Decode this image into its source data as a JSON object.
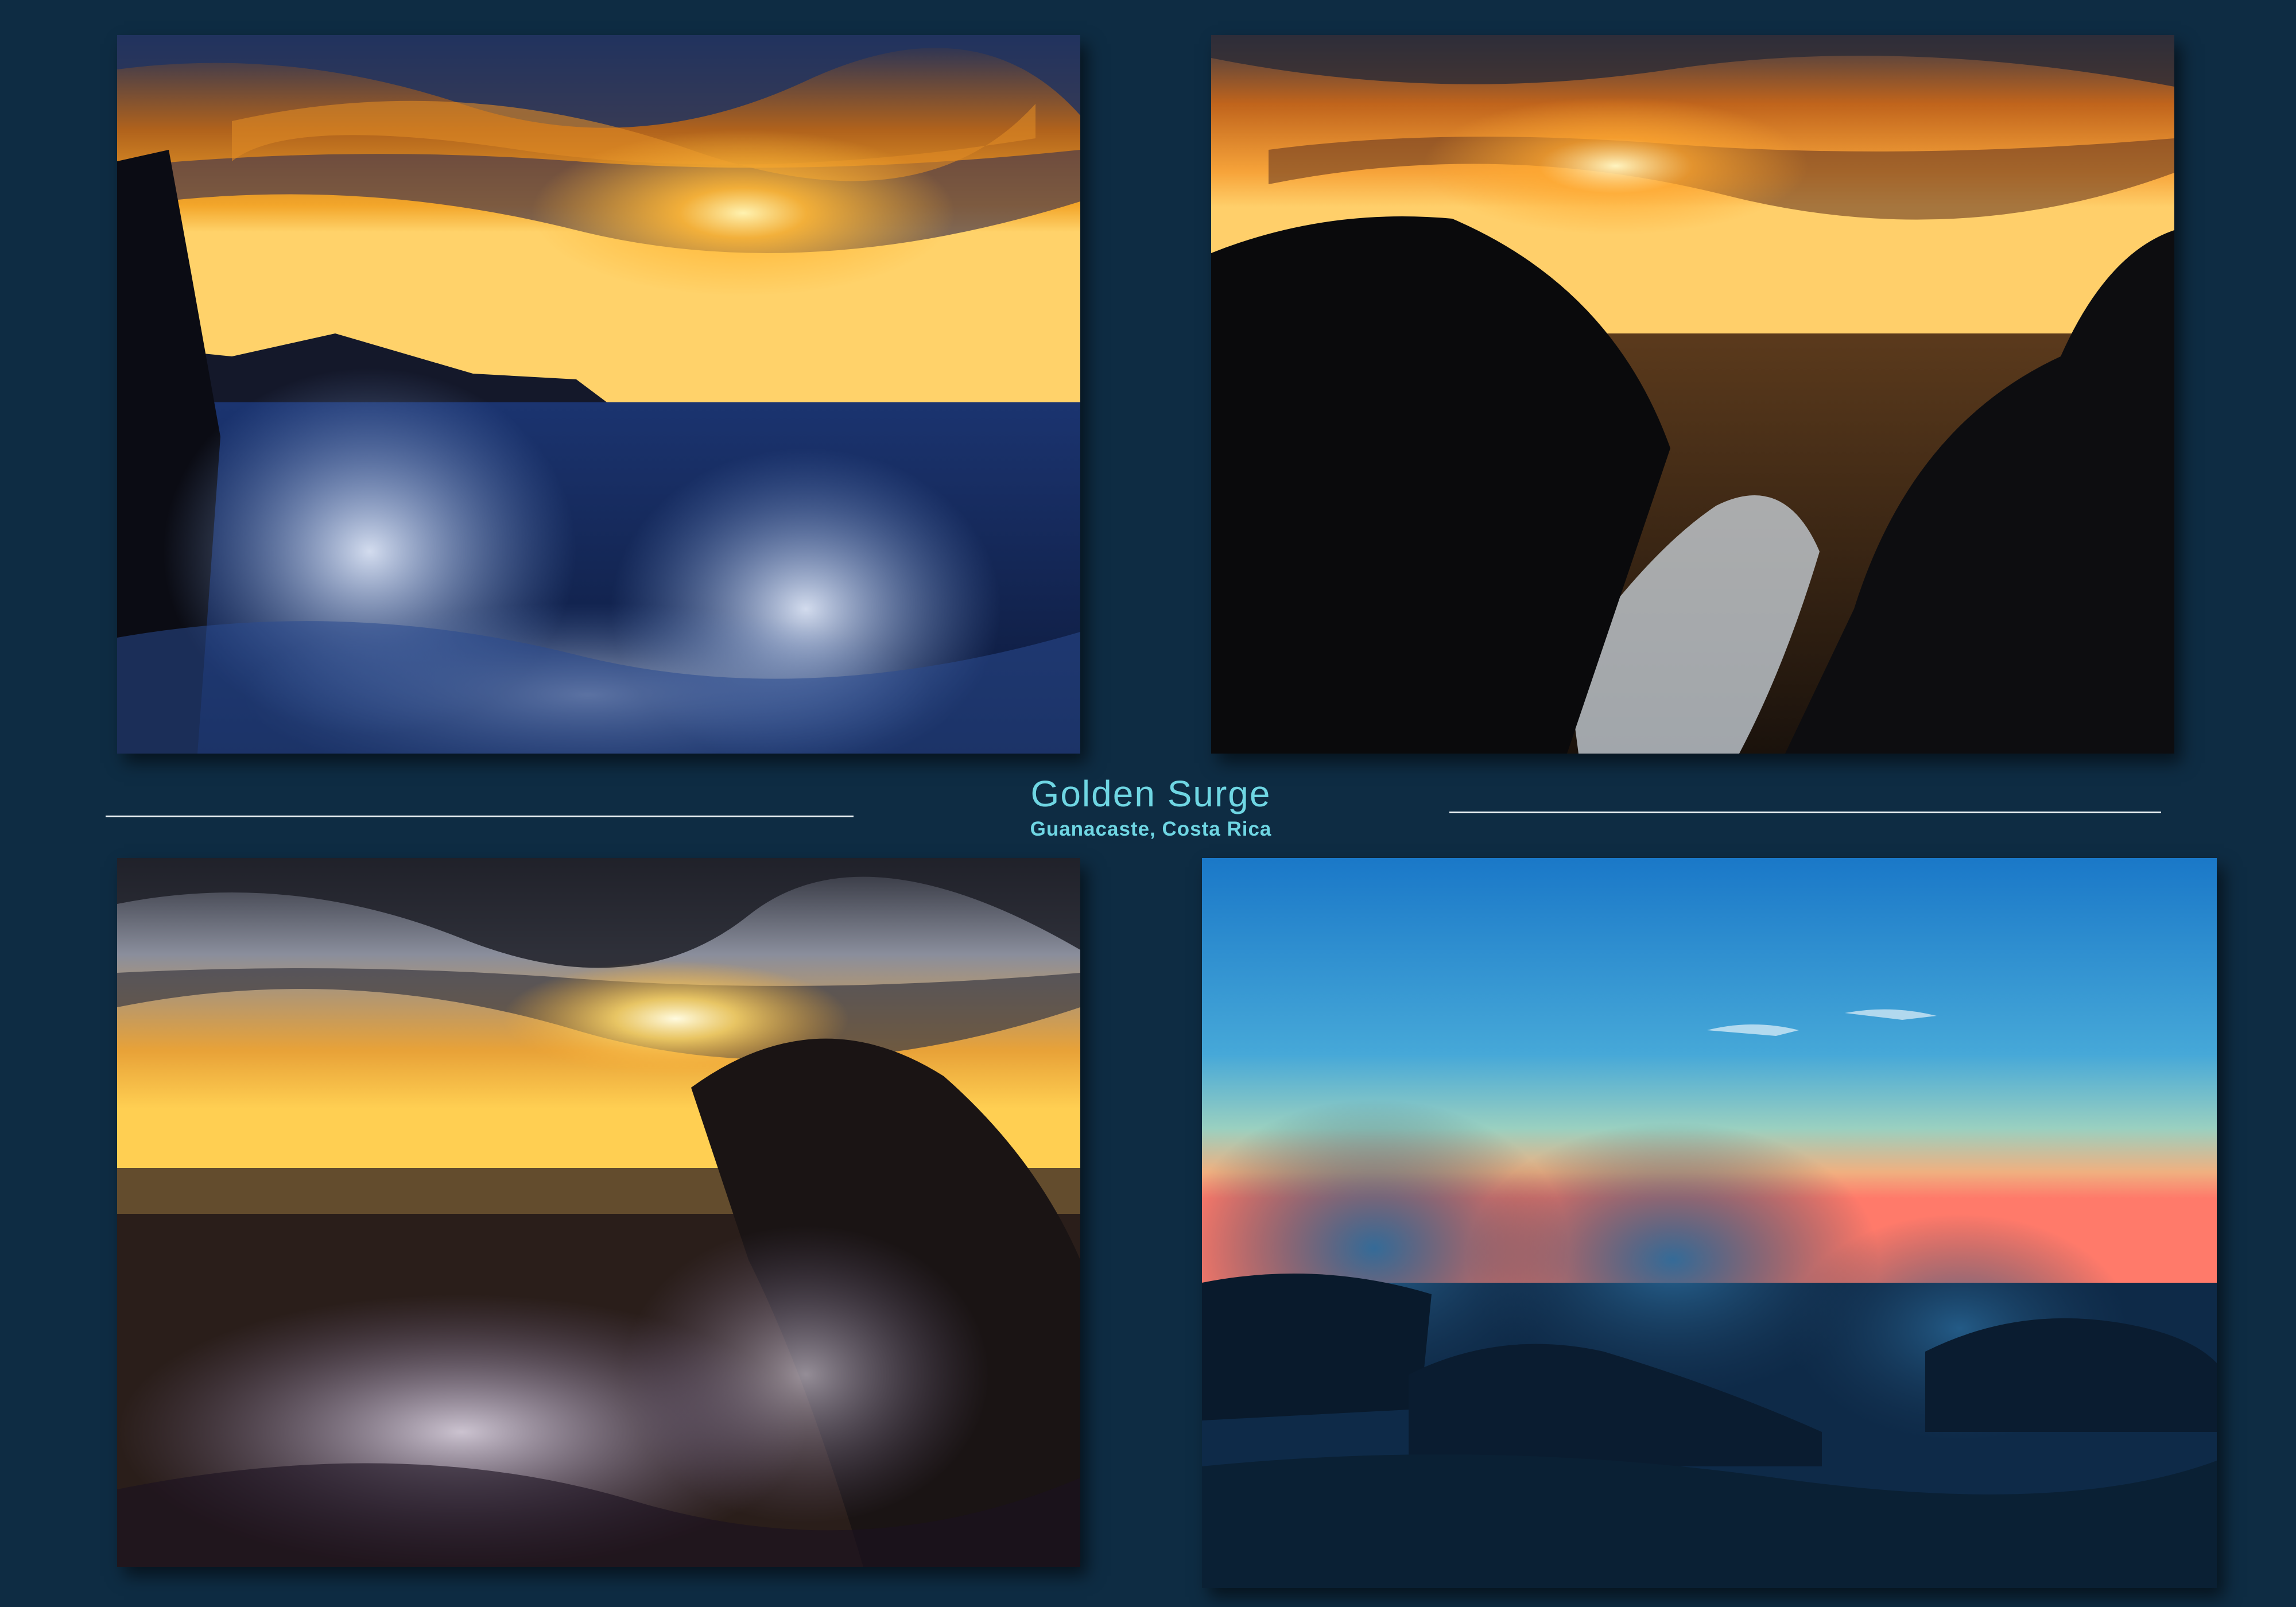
{
  "caption": {
    "title": "Golden Surge",
    "subtitle": "Guanacaste, Costa Rica"
  },
  "colors": {
    "background": "#0e2c43",
    "caption_text": "#6fd6e3",
    "rule": "#e9f0f3"
  },
  "photos": [
    {
      "id": "photo-1",
      "subject": "wave splash at golden sunset"
    },
    {
      "id": "photo-2",
      "subject": "spray between dark rocks at sunset"
    },
    {
      "id": "photo-3",
      "subject": "wave curl with bright sun near horizon"
    },
    {
      "id": "photo-4",
      "subject": "blue-hour wave crash over rocks"
    }
  ]
}
